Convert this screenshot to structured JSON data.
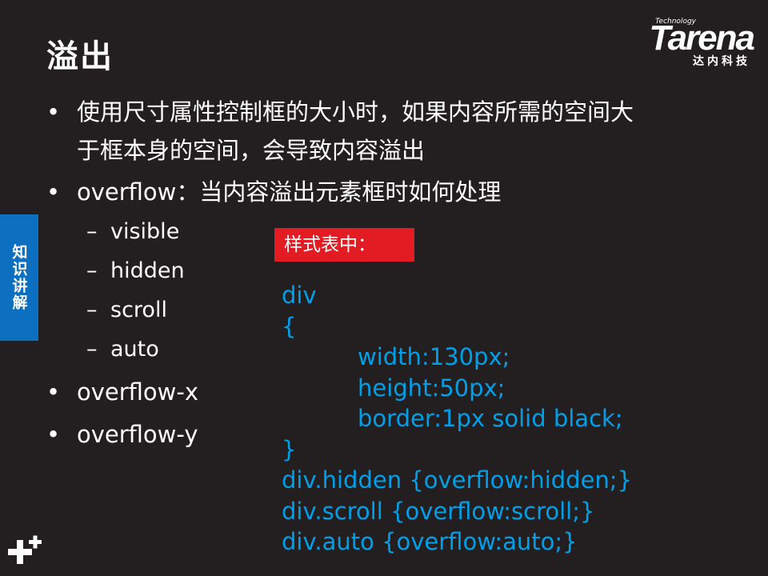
{
  "slide": {
    "title": "溢出",
    "bullets": [
      {
        "dot": "•",
        "line1": "使用尺寸属性控制框的大小时，如果内容所需的空间大",
        "line2": "于框本身的空间，会导致内容溢出"
      },
      {
        "dot": "•",
        "line1": "overflow：当内容溢出元素框时如何处理"
      },
      {
        "dot": "•",
        "line1": "overflow-x"
      },
      {
        "dot": "•",
        "line1": "overflow-y"
      }
    ],
    "sub_items": [
      {
        "dash": "–",
        "text": "visible"
      },
      {
        "dash": "–",
        "text": "hidden"
      },
      {
        "dash": "–",
        "text": "scroll"
      },
      {
        "dash": "–",
        "text": "auto"
      }
    ]
  },
  "logo": {
    "technology": "Technology",
    "brand": "Tarena",
    "subtitle": "达内科技"
  },
  "side_tab": {
    "label": "知识讲解"
  },
  "code_block": {
    "label": "样式表中：",
    "lines": [
      "div",
      "{",
      "width:130px;",
      "height:50px;",
      "border:1px solid black;",
      "}",
      "div.hidden {overflow:hidden;}",
      "div.scroll {overflow:scroll;}",
      "div.auto {overflow:auto;}"
    ]
  },
  "colors": {
    "background": "#231f20",
    "code_text": "#00a0e9",
    "label_bg": "#e31b23",
    "side_tab_bg": "#0c6fc0"
  }
}
